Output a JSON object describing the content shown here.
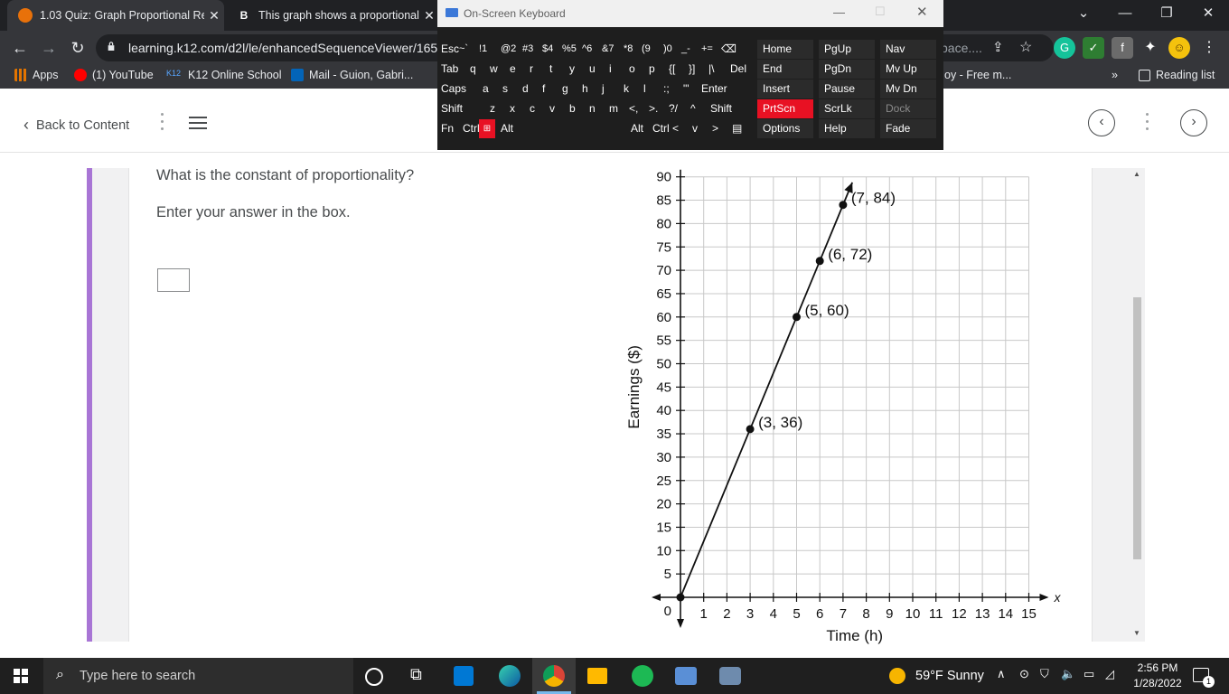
{
  "browser": {
    "tabs": [
      {
        "title": "1.03 Quiz: Graph Proportional Re",
        "active": true
      },
      {
        "title": "This graph shows a proportional",
        "active": false
      }
    ],
    "url": "learning.k12.com/d2l/le/enhancedSequenceViewer/165",
    "url_tail": "pace....",
    "bookmarks": [
      "Apps",
      "(1) YouTube",
      "K12 Online School",
      "Mail - Guion, Gabri...",
      "oy - Free m...",
      "»",
      "Reading list"
    ]
  },
  "app": {
    "back_label": "Back to Content"
  },
  "question": {
    "prompt": "What is the constant of proportionality?",
    "instruction": "Enter your answer in the box.",
    "answer": ""
  },
  "chart_data": {
    "type": "line",
    "xlabel": "Time (h)",
    "ylabel": "Earnings ($)",
    "xlim": [
      0,
      15
    ],
    "ylim": [
      0,
      90
    ],
    "xticks": [
      1,
      2,
      3,
      4,
      5,
      6,
      7,
      8,
      9,
      10,
      11,
      12,
      13,
      14,
      15
    ],
    "yticks": [
      5,
      10,
      15,
      20,
      25,
      30,
      35,
      40,
      45,
      50,
      55,
      60,
      65,
      70,
      75,
      80,
      85,
      90
    ],
    "origin_label": "0",
    "x_axis_arrow_label": "x",
    "grid": true,
    "series": [
      {
        "x": [
          0,
          7.4
        ],
        "y": [
          0,
          88.8
        ]
      }
    ],
    "points": [
      {
        "x": 0,
        "y": 0,
        "label": ""
      },
      {
        "x": 3,
        "y": 36,
        "label": "(3, 36)"
      },
      {
        "x": 5,
        "y": 60,
        "label": "(5, 60)"
      },
      {
        "x": 6,
        "y": 72,
        "label": "(6, 72)"
      },
      {
        "x": 7,
        "y": 84,
        "label": "(7, 84)"
      }
    ]
  },
  "osk": {
    "title": "On-Screen Keyboard",
    "rows": [
      [
        "Esc",
        "~`",
        "!1",
        "@2",
        "#3",
        "$4",
        "%5",
        "^6",
        "&7",
        "*8",
        "(9",
        ")0",
        "_-",
        "+=",
        "⌫"
      ],
      [
        "Tab",
        "q",
        "w",
        "e",
        "r",
        "t",
        "y",
        "u",
        "i",
        "o",
        "p",
        "{[",
        "}]",
        "|\\",
        "Del"
      ],
      [
        "Caps",
        "a",
        "s",
        "d",
        "f",
        "g",
        "h",
        "j",
        "k",
        "l",
        ":;",
        "\"'",
        "Enter"
      ],
      [
        "Shift",
        "z",
        "x",
        "c",
        "v",
        "b",
        "n",
        "m",
        "<,",
        ">.",
        "?/",
        "^",
        "Shift"
      ],
      [
        "Fn",
        "Ctrl",
        "Win",
        "Alt",
        "Alt",
        "Ctrl",
        "<",
        "v",
        ">",
        "▤"
      ]
    ],
    "side": [
      [
        "Home",
        "PgUp",
        "Nav"
      ],
      [
        "End",
        "PgDn",
        "Mv Up"
      ],
      [
        "Insert",
        "Pause",
        "Mv Dn"
      ],
      [
        "PrtScn",
        "ScrLk",
        "Dock"
      ],
      [
        "Options",
        "Help",
        "Fade"
      ]
    ]
  },
  "taskbar": {
    "search_placeholder": "Type here to search",
    "weather": "59°F  Sunny",
    "time": "2:56 PM",
    "date": "1/28/2022",
    "notification_count": "1"
  },
  "colors": {
    "accent_purple": "#a875d5",
    "chrome_dark": "#202124",
    "chrome_bar": "#35363a",
    "osk_red": "#e81123"
  }
}
